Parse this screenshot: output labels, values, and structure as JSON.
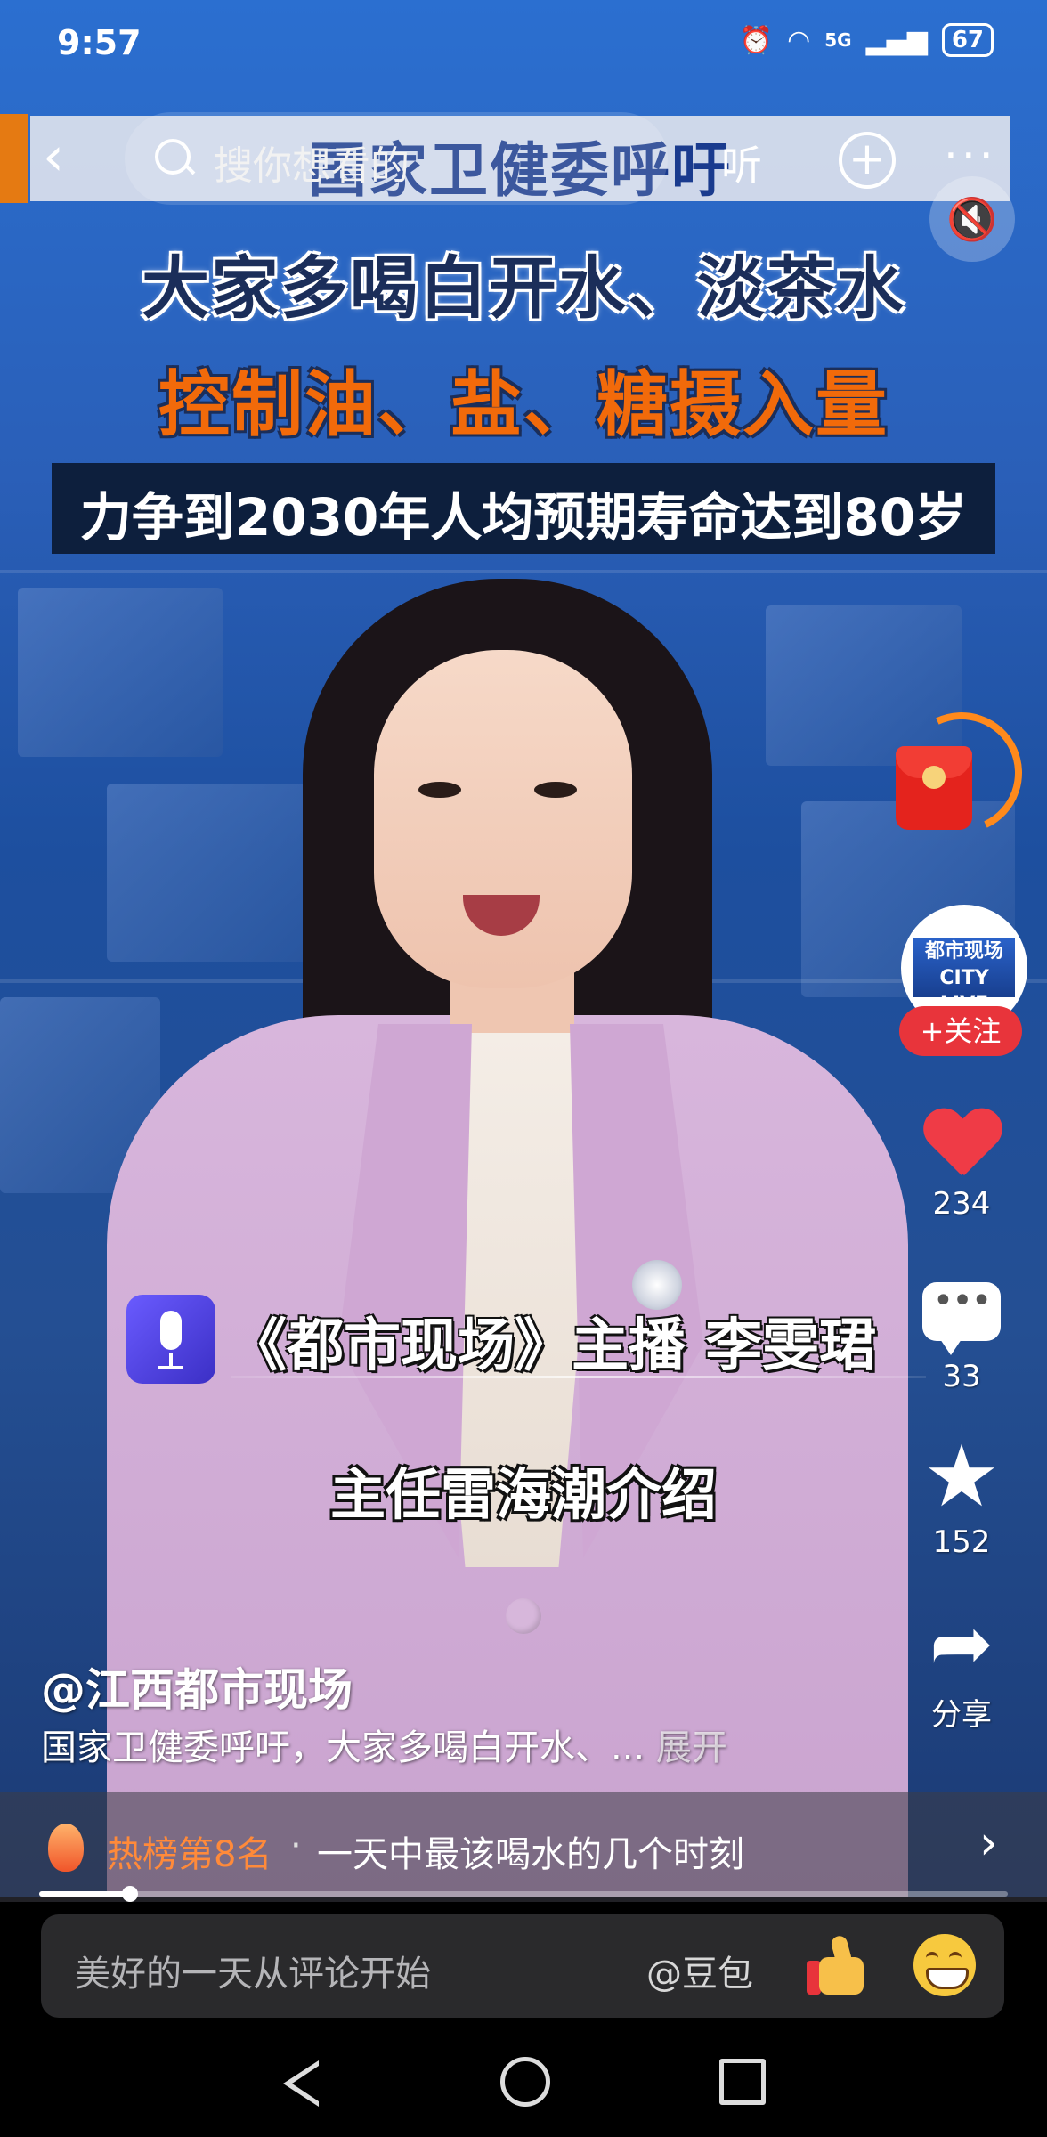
{
  "status_bar": {
    "time": "9:57",
    "network": "5G",
    "battery": "67"
  },
  "top_bar": {
    "search_placeholder": "搜你想看的",
    "search_button": "听"
  },
  "video": {
    "overlay_title": "国家卫健委呼吁",
    "headline_1": "大家多喝白开水、淡茶水",
    "headline_2": "控制油、盐、糖摄入量",
    "headline_3": "力争到2030年人均预期寿命达到80岁",
    "caption_1": "《都市现场》主播 李雯珺",
    "caption_2": "主任雷海潮介绍",
    "progress_fraction": 0.094
  },
  "channel": {
    "avatar_text": "都市现场 CITY LIVE",
    "follow_label": "+关注"
  },
  "actions": {
    "likes": "234",
    "comments": "33",
    "favorites": "152",
    "share_label": "分享"
  },
  "post": {
    "author": "@江西都市现场",
    "description": "国家卫健委呼吁，大家多喝白开水、...",
    "expand_label": "展开"
  },
  "hot_list": {
    "rank_label": "热榜第8名",
    "separator": "·",
    "title": "一天中最该喝水的几个时刻"
  },
  "comment_bar": {
    "placeholder": "美好的一天从评论开始",
    "mention": "@豆包"
  },
  "colors": {
    "accent_red": "#e8343b",
    "hot_orange": "#ff8a3a",
    "headline_orange": "#f26a0a"
  }
}
